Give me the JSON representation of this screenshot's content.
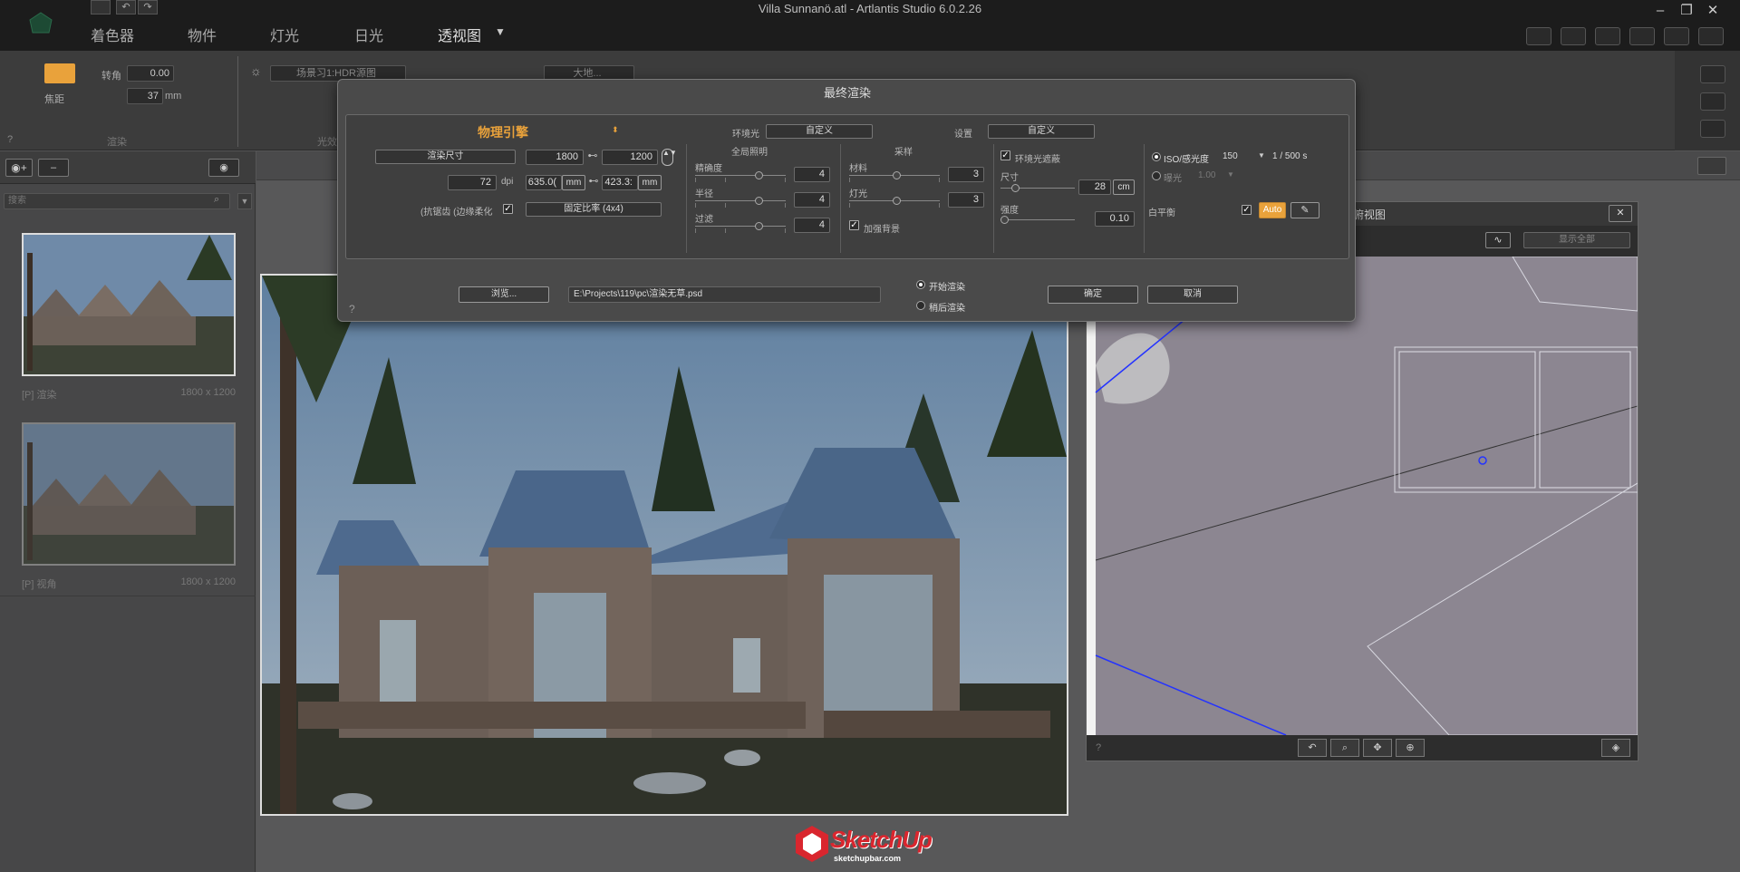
{
  "window": {
    "title": "Villa Sunnanö.atl - Artlantis Studio 6.0.2.26"
  },
  "menu": {
    "shaders": "着色器",
    "objects": "物件",
    "lights": "灯光",
    "sun": "日光",
    "perspective": "透视图"
  },
  "toolbar": {
    "angle_label": "转角",
    "angle_value": "0.00",
    "focal_label": "焦距",
    "focal_value": "37",
    "focal_unit": "mm",
    "hdr_value": "场景习1:HDR源图",
    "large_label": "大地...",
    "render_section": "渲染",
    "light_section": "光效",
    "help": "?"
  },
  "left_panel": {
    "search_placeholder": "搜索",
    "views": [
      {
        "name": "[P] 渲染",
        "size": "1800 x 1200"
      },
      {
        "name": "[P] 视角",
        "size": "1800 x 1200"
      }
    ]
  },
  "plan_view": {
    "title": "俯视图",
    "display_mode": "显示全部",
    "help": "?"
  },
  "dialog": {
    "title": "最终渲染",
    "engine": "物理引擎",
    "env_label": "环境光",
    "env_value": "自定义",
    "settings_label": "设置",
    "settings_value": "自定义",
    "render_size_label": "渲染尺寸",
    "width": "1800",
    "height": "1200",
    "dpi_value": "72",
    "dpi_label": "dpi",
    "mm_width": "635.0(",
    "mm_height": "423.3:",
    "mm_label": "mm",
    "aa_label": "(抗锯齿 (边缘柔化",
    "ratio_value": "固定比率 (4x4)",
    "global_illum": "全局照明",
    "precision_label": "精确度",
    "precision_value": "4",
    "radius_label": "半径",
    "radius_value": "4",
    "filter_label": "过滤",
    "filter_value": "4",
    "sampling": "采样",
    "material_label": "材料",
    "material_value": "3",
    "light_label": "灯光",
    "light_value": "3",
    "enhance_bg": "加强背景",
    "ao_label": "环境光遮蔽",
    "size_label": "尺寸",
    "size_value": "28",
    "size_unit": "cm",
    "strength_label": "强度",
    "strength_value": "0.10",
    "iso_label": "ISO/感光度",
    "iso_value": "150",
    "shutter": "1 / 500 s",
    "exposure_label": "曝光",
    "exposure_value": "1.00",
    "wb_label": "白平衡",
    "auto_label": "Auto",
    "browse_label": "浏览...",
    "path_value": "E:\\Projects\\119\\pc\\渲染无草.psd",
    "start_render": "开始渲染",
    "later_render": "稍后渲染",
    "ok_label": "确定",
    "cancel_label": "取消",
    "help": "?"
  },
  "watermark": {
    "brand": "SketchUp",
    "url": "sketchupbar.com"
  },
  "colors": {
    "accent": "#e9a23b",
    "selection_blue": "#2433ff",
    "plan_bg": "#8c8691"
  }
}
